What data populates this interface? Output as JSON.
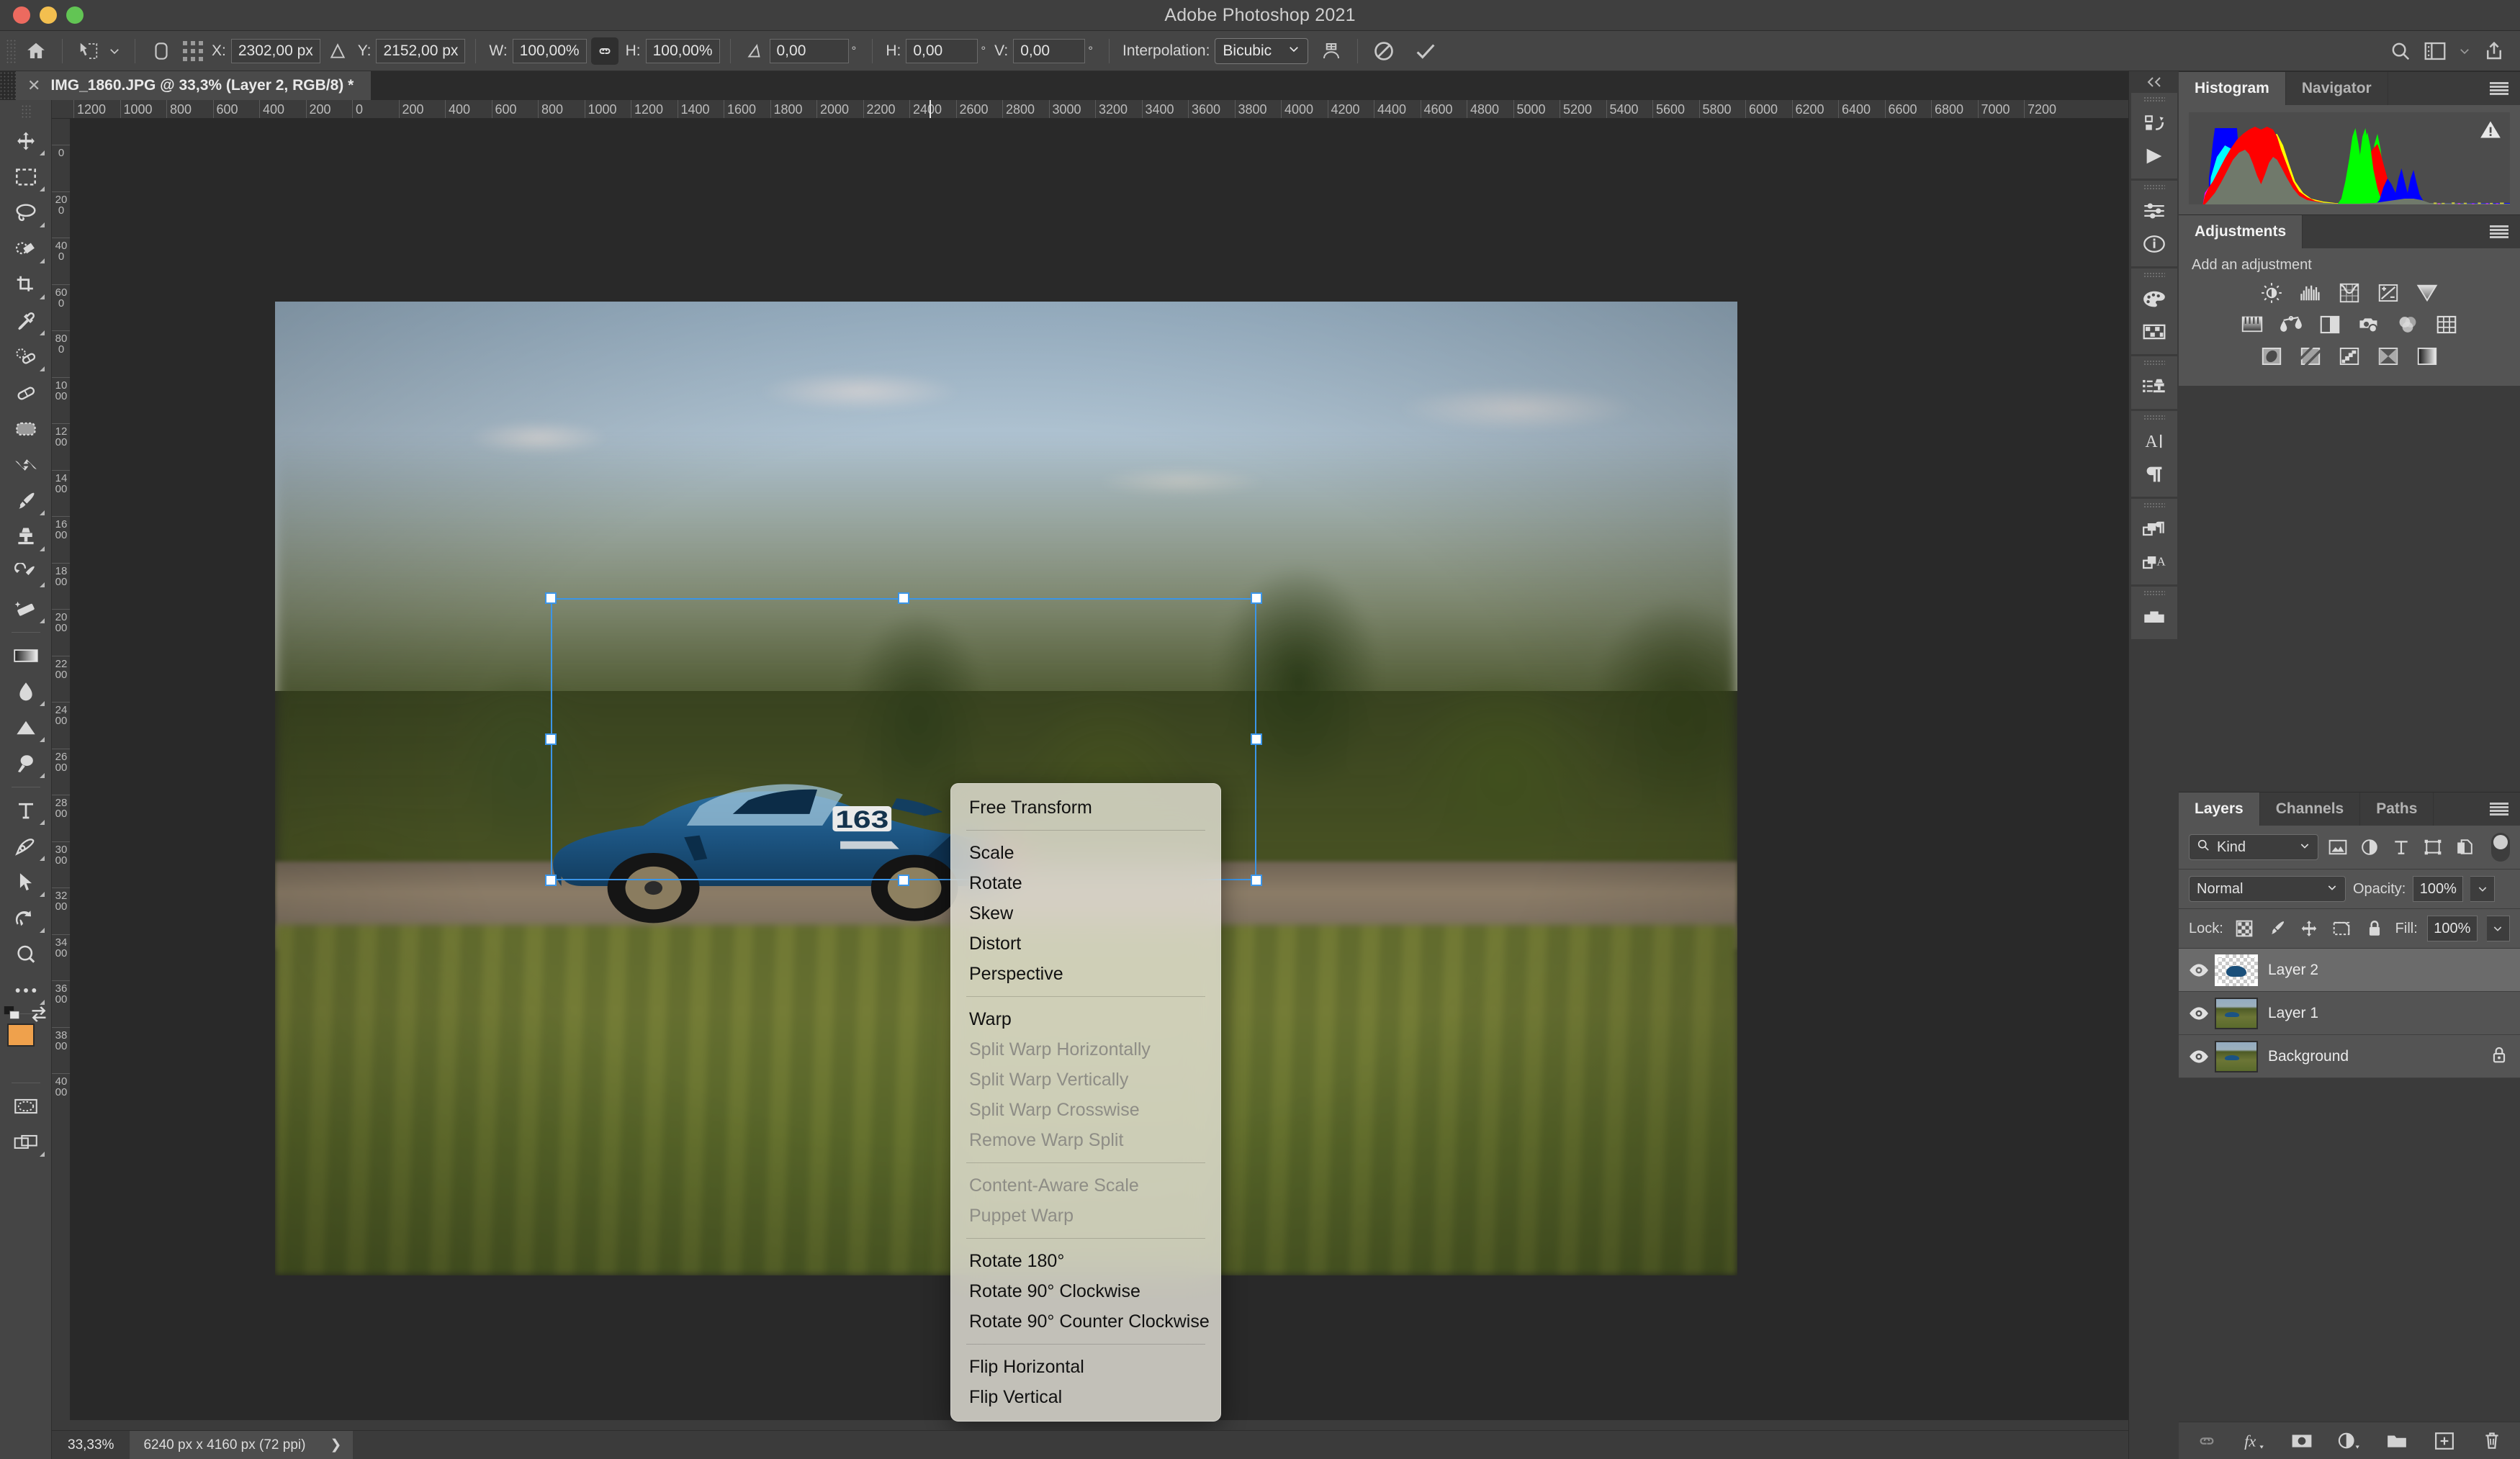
{
  "window": {
    "title": "Adobe Photoshop 2021",
    "traffic_lights": [
      "close",
      "minimize",
      "maximize"
    ]
  },
  "options_bar": {
    "home_icon": "home-icon",
    "tool_preset_icon": "move-tool-preset-icon",
    "preset_caret": "chevron-down-icon",
    "reference_point_icon": "reference-point-icon",
    "x_label": "X:",
    "x_value": "2302,00 px",
    "delta_icon": "delta-triangle-icon",
    "y_label": "Y:",
    "y_value": "2152,00 px",
    "w_label": "W:",
    "w_value": "100,00%",
    "link_icon": "link-chain-icon",
    "h_label": "H:",
    "h_value": "100,00%",
    "angle_icon": "angle-icon",
    "angle_value": "0,00",
    "degree_unit": "°",
    "skew_h_label": "H:",
    "skew_h_value": "0,00",
    "skew_v_label": "V:",
    "skew_v_value": "0,00",
    "interpolation_label": "Interpolation:",
    "interpolation_value": "Bicubic",
    "warp_icon": "warp-toggle-icon",
    "cancel_icon": "cancel-transform-icon",
    "commit_icon": "commit-transform-icon",
    "search_icon": "search-icon",
    "workspace_icon": "workspace-layout-icon",
    "workspace_caret": "chevron-down-icon",
    "share_icon": "share-export-icon"
  },
  "document_tab": {
    "close_icon": "close-icon",
    "title": "IMG_1860.JPG @ 33,3% (Layer 2, RGB/8) *"
  },
  "toolbar": {
    "tools": [
      {
        "name": "move-tool",
        "icon": "move-arrows-icon",
        "has_submenu": true
      },
      {
        "name": "rectangular-marquee-tool",
        "icon": "marquee-rect-icon",
        "has_submenu": true
      },
      {
        "name": "lasso-tool",
        "icon": "lasso-icon",
        "has_submenu": true
      },
      {
        "name": "object-selection-tool",
        "icon": "quick-selection-icon",
        "has_submenu": true
      },
      {
        "name": "crop-tool",
        "icon": "crop-icon",
        "has_submenu": true
      },
      {
        "name": "eyedropper-tool",
        "icon": "eyedropper-icon",
        "has_submenu": true
      },
      {
        "name": "spot-healing-brush-tool",
        "icon": "spot-healing-icon",
        "has_submenu": true
      },
      {
        "name": "healing-brush-tool",
        "icon": "bandage-icon",
        "has_submenu": false
      },
      {
        "name": "patch-tool",
        "icon": "patch-icon",
        "has_submenu": false
      },
      {
        "name": "content-aware-move-tool",
        "icon": "content-aware-move-icon",
        "has_submenu": false
      },
      {
        "name": "brush-tool",
        "icon": "paintbrush-icon",
        "has_submenu": true
      },
      {
        "name": "clone-stamp-tool",
        "icon": "clone-stamp-icon",
        "has_submenu": true
      },
      {
        "name": "history-brush-tool",
        "icon": "history-brush-icon",
        "has_submenu": true
      },
      {
        "name": "eraser-tool",
        "icon": "eraser-icon",
        "has_submenu": true
      },
      {
        "name": "gradient-tool",
        "icon": "gradient-icon",
        "has_submenu": true
      },
      {
        "name": "blur-tool",
        "icon": "blur-drop-icon",
        "has_submenu": true
      },
      {
        "name": "dodge-tool",
        "icon": "dodge-triangle-icon",
        "has_submenu": true
      },
      {
        "name": "burn-tool",
        "icon": "burn-hand-icon",
        "has_submenu": true
      },
      {
        "name": "type-tool",
        "icon": "type-t-icon",
        "has_submenu": true
      },
      {
        "name": "pen-tool",
        "icon": "pen-icon",
        "has_submenu": true
      },
      {
        "name": "path-selection-tool",
        "icon": "path-arrow-icon",
        "has_submenu": true
      },
      {
        "name": "rotate-view-tool",
        "icon": "hand-rotate-icon",
        "has_submenu": true
      },
      {
        "name": "zoom-tool",
        "icon": "magnifier-icon",
        "has_submenu": false
      },
      {
        "name": "edit-toolbar",
        "icon": "ellipsis-icon",
        "has_submenu": true
      }
    ],
    "default_colors_icon": "default-colors-icon",
    "swap_colors_icon": "swap-colors-icon",
    "foreground_color": "#efa14c",
    "background_color": "#ffffff",
    "quick_mask_icon": "quick-mask-icon",
    "screen_mode_icon": "screen-mode-icon"
  },
  "rulers": {
    "horizontal_labels": [
      "1200",
      "1000",
      "800",
      "600",
      "400",
      "200",
      "0",
      "200",
      "400",
      "600",
      "800",
      "1000",
      "1200",
      "1400",
      "1600",
      "1800",
      "2000",
      "2200",
      "2400",
      "2600",
      "2800",
      "3000",
      "3200",
      "3400",
      "3600",
      "3800",
      "4000",
      "4200",
      "4400",
      "4600",
      "4800",
      "5000",
      "5200",
      "5400",
      "5600",
      "5800",
      "6000",
      "6200",
      "6400",
      "6600",
      "6800",
      "7000",
      "7200"
    ],
    "vertical_labels": [
      "0",
      "200",
      "400",
      "600",
      "800",
      "1000",
      "1200",
      "1400",
      "1600",
      "1800",
      "2000",
      "2200",
      "2400",
      "2600",
      "2800",
      "3000",
      "3200",
      "3400",
      "3600",
      "3800",
      "4000"
    ],
    "cursor_x_label": "2400"
  },
  "canvas": {
    "photo_alt": "blue BMW M4 race car number 163 panning shot on road",
    "car_number": "163",
    "transform_handles": [
      "top-left",
      "top-center",
      "top-right",
      "middle-left",
      "middle-right",
      "bottom-left",
      "bottom-center",
      "bottom-right"
    ],
    "selection_color": "#3b95e8"
  },
  "context_menu": {
    "groups": [
      {
        "items": [
          {
            "label": "Free Transform",
            "disabled": false
          }
        ]
      },
      {
        "items": [
          {
            "label": "Scale",
            "disabled": false
          },
          {
            "label": "Rotate",
            "disabled": false
          },
          {
            "label": "Skew",
            "disabled": false
          },
          {
            "label": "Distort",
            "disabled": false
          },
          {
            "label": "Perspective",
            "disabled": false
          }
        ]
      },
      {
        "items": [
          {
            "label": "Warp",
            "disabled": false
          },
          {
            "label": "Split Warp Horizontally",
            "disabled": true
          },
          {
            "label": "Split Warp Vertically",
            "disabled": true
          },
          {
            "label": "Split Warp Crosswise",
            "disabled": true
          },
          {
            "label": "Remove Warp Split",
            "disabled": true
          }
        ]
      },
      {
        "items": [
          {
            "label": "Content-Aware Scale",
            "disabled": true
          },
          {
            "label": "Puppet Warp",
            "disabled": true
          }
        ]
      },
      {
        "items": [
          {
            "label": "Rotate 180°",
            "disabled": false
          },
          {
            "label": "Rotate 90° Clockwise",
            "disabled": false
          },
          {
            "label": "Rotate 90° Counter Clockwise",
            "disabled": false
          }
        ]
      },
      {
        "items": [
          {
            "label": "Flip Horizontal",
            "disabled": false
          },
          {
            "label": "Flip Vertical",
            "disabled": false
          }
        ]
      }
    ]
  },
  "right_rail": {
    "collapse_icon": "collapse-panels-icon",
    "groups": [
      {
        "icons": [
          "history-icon",
          "actions-play-icon"
        ]
      },
      {
        "icons": [
          "properties-sliders-icon",
          "info-circle-icon"
        ]
      },
      {
        "icons": [
          "color-palette-icon",
          "swatches-grid-icon"
        ]
      },
      {
        "icons": [
          "clone-source-icon"
        ]
      },
      {
        "icons": [
          "character-icon",
          "paragraph-icon"
        ]
      },
      {
        "icons": [
          "paragraph-styles-icon",
          "character-styles-icon"
        ]
      },
      {
        "icons": [
          "libraries-icon"
        ]
      }
    ]
  },
  "histogram_panel": {
    "tabs": [
      {
        "label": "Histogram",
        "active": true
      },
      {
        "label": "Navigator",
        "active": false
      }
    ],
    "menu_icon": "panel-menu-icon",
    "warning_icon": "cached-data-warning-icon"
  },
  "adjustments_panel": {
    "tab_label": "Adjustments",
    "menu_icon": "panel-menu-icon",
    "subtitle": "Add an adjustment",
    "rows": [
      [
        "brightness-contrast-icon",
        "levels-icon",
        "curves-icon",
        "exposure-icon",
        "vibrance-icon"
      ],
      [
        "hue-saturation-icon",
        "color-balance-icon",
        "black-white-icon",
        "photo-filter-icon",
        "channel-mixer-icon",
        "color-lookup-icon"
      ],
      [
        "invert-icon",
        "posterize-icon",
        "threshold-icon",
        "gradient-map-icon",
        "selective-color-icon"
      ]
    ]
  },
  "layers_panel": {
    "tabs": [
      {
        "label": "Layers",
        "active": true
      },
      {
        "label": "Channels",
        "active": false
      },
      {
        "label": "Paths",
        "active": false
      }
    ],
    "menu_icon": "panel-menu-icon",
    "filter": {
      "search_icon": "search-icon",
      "kind_label": "Kind",
      "caret_icon": "chevron-down-icon",
      "type_filters": [
        "filter-pixel-icon",
        "filter-adjustment-icon",
        "filter-type-icon",
        "filter-shape-icon",
        "filter-smart-object-icon"
      ],
      "toggle_icon": "filter-toggle-switch"
    },
    "blend_mode": "Normal",
    "blend_caret_icon": "chevron-down-icon",
    "opacity_label": "Opacity:",
    "opacity_value": "100%",
    "opacity_caret_icon": "chevron-down-icon",
    "lock_label": "Lock:",
    "lock_icons": [
      "lock-transparent-pixels-icon",
      "lock-image-pixels-icon",
      "lock-position-icon",
      "lock-artboard-icon",
      "lock-all-icon"
    ],
    "fill_label": "Fill:",
    "fill_value": "100%",
    "fill_caret_icon": "chevron-down-icon",
    "layers": [
      {
        "name": "Layer 2",
        "visible": true,
        "selected": true,
        "locked": false,
        "thumb": "transparent-car-cutout"
      },
      {
        "name": "Layer 1",
        "visible": true,
        "selected": false,
        "locked": false,
        "thumb": "photo"
      },
      {
        "name": "Background",
        "visible": true,
        "selected": false,
        "locked": true,
        "thumb": "photo"
      }
    ],
    "eye_icon": "eye-visibility-icon",
    "lock_badge_icon": "lock-icon",
    "footer_icons": [
      "link-layers-icon",
      "layer-style-fx-icon",
      "add-layer-mask-icon",
      "new-adjustment-layer-icon",
      "new-group-icon",
      "new-layer-icon",
      "delete-layer-icon"
    ]
  },
  "status_bar": {
    "zoom": "33,33%",
    "doc_info": "6240 px x 4160 px (72 ppi)",
    "expand_icon": "chevron-right-icon"
  }
}
